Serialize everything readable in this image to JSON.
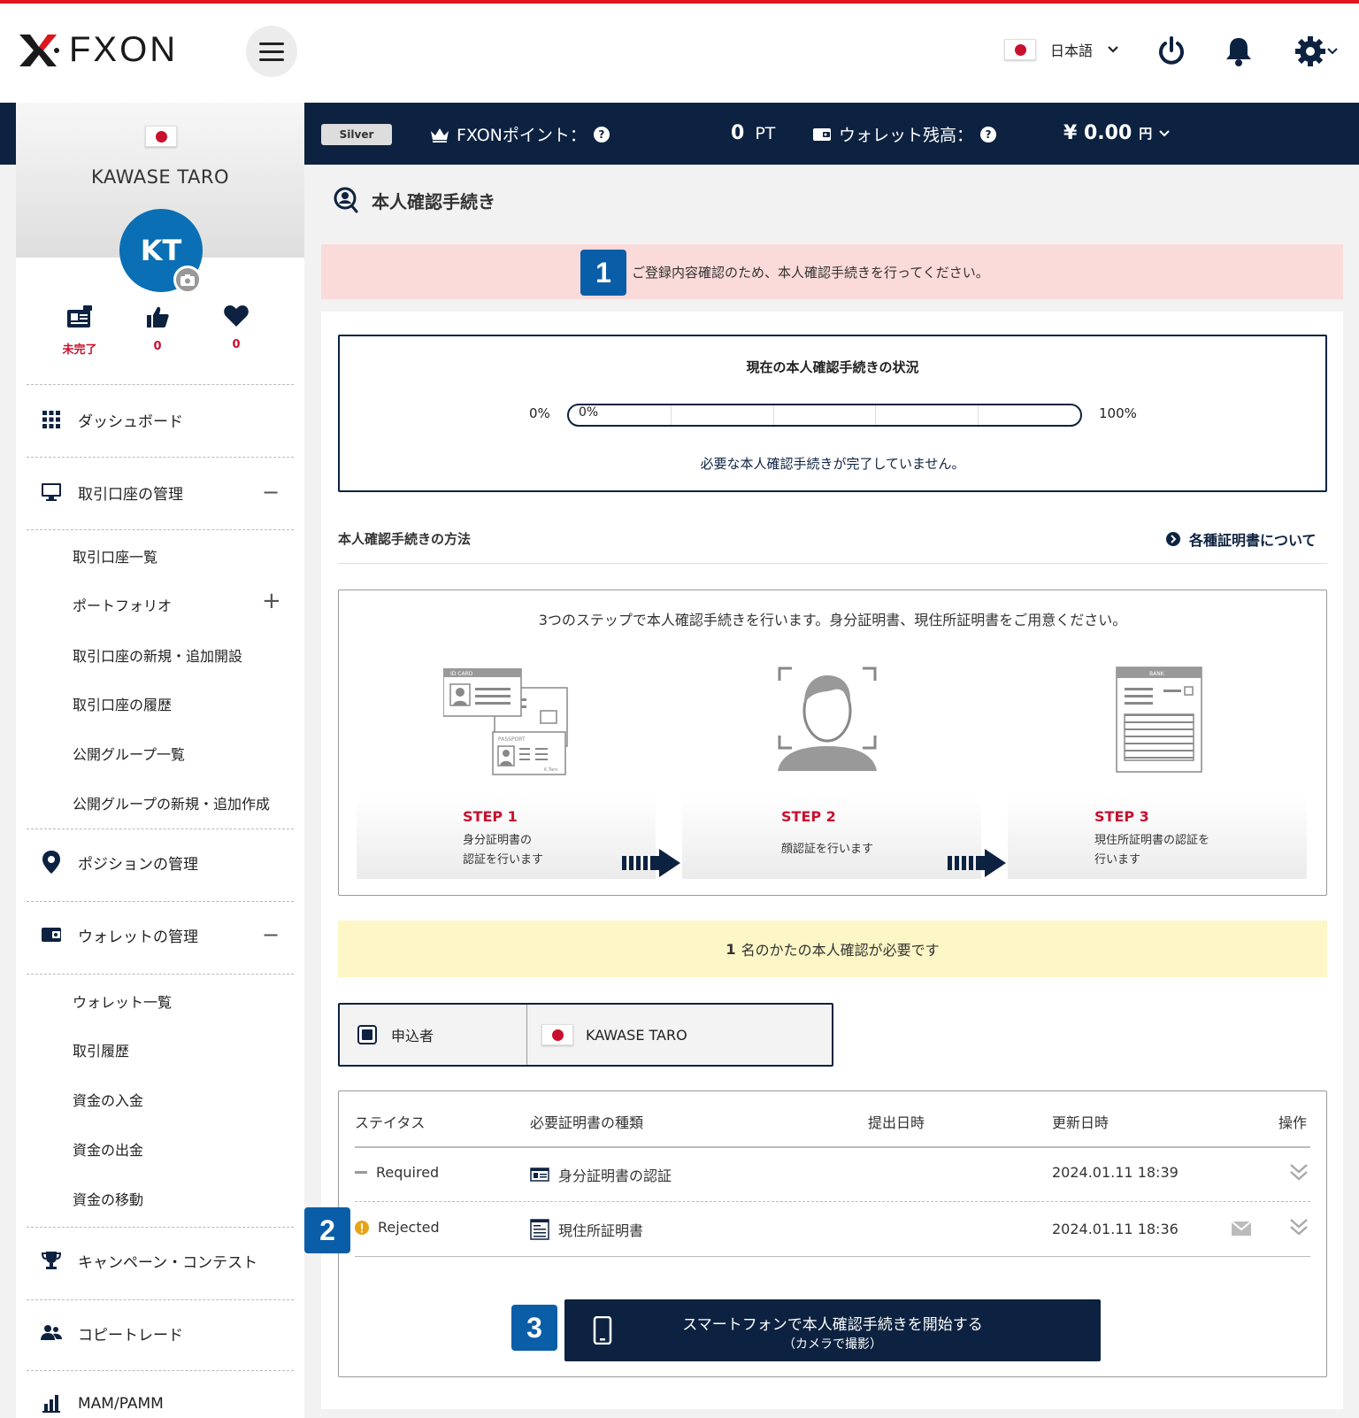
{
  "header": {
    "logo_text": "FXON",
    "language": "日本語"
  },
  "status_bar": {
    "tier": "Silver",
    "points_label": "FXONポイント：",
    "points_value": "0",
    "points_unit": "PT",
    "wallet_label": "ウォレット残高：",
    "wallet_value": "¥ 0.00",
    "wallet_unit": "円"
  },
  "sidebar": {
    "user_name": "KAWASE TARO",
    "avatar_initials": "KT",
    "stats": [
      {
        "icon": "id-card-icon",
        "value": "未完了"
      },
      {
        "icon": "thumbs-up-icon",
        "value": "0"
      },
      {
        "icon": "heart-icon",
        "value": "0"
      }
    ],
    "nav": {
      "dashboard": "ダッシュボード",
      "accounts": "取引口座の管理",
      "accounts_sub": [
        "取引口座一覧",
        "ポートフォリオ",
        "取引口座の新規・追加開設",
        "取引口座の履歴",
        "公開グループ一覧",
        "公開グループの新規・追加作成"
      ],
      "positions": "ポジションの管理",
      "wallet": "ウォレットの管理",
      "wallet_sub": [
        "ウォレット一覧",
        "取引履歴",
        "資金の入金",
        "資金の出金",
        "資金の移動"
      ],
      "campaign": "キャンペーン・コンテスト",
      "copytrade": "コピートレード",
      "mam": "MAM/PAMM"
    }
  },
  "main": {
    "page_title": "本人確認手続き",
    "alert_text": "ご登録内容確認のため、本人確認手続きを行ってください。",
    "badges": [
      "1",
      "2",
      "3"
    ],
    "status_box": {
      "title": "現在の本人確認手続きの状況",
      "min_label": "0%",
      "max_label": "100%",
      "progress_label": "0%",
      "progress": 0,
      "message": "必要な本人確認手続きが完了していません。"
    },
    "method_title": "本人確認手続きの方法",
    "method_link": "各種証明書について",
    "steps_intro": "3つのステップで本人確認手続きを行います。身分証明書、現住所証明書をご用意ください。",
    "steps": [
      {
        "title": "STEP 1",
        "line1": "身分証明書の",
        "line2": "認証を行います"
      },
      {
        "title": "STEP 2",
        "line1": "顔認証を行います",
        "line2": ""
      },
      {
        "title": "STEP 3",
        "line1": "現住所証明書の認証を",
        "line2": "行います"
      }
    ],
    "illustration_text": {
      "id_card": "ID CARD",
      "passport": "PASSPORT",
      "passport_sign": "K.Taro",
      "bank": "BANK"
    },
    "notice_count": "1",
    "notice_text": "名のかたの本人確認が必要です",
    "applicant_label": "申込者",
    "applicant_name": "KAWASE TARO",
    "table": {
      "headers": [
        "ステイタス",
        "必要証明書の種類",
        "提出日時",
        "更新日時",
        "操作"
      ],
      "rows": [
        {
          "status": "Required",
          "doc": "身分証明書の認証",
          "submitted": "",
          "updated": "2024.01.11 18:39"
        },
        {
          "status": "Rejected",
          "doc": "現住所証明書",
          "submitted": "",
          "updated": "2024.01.11 18:36"
        }
      ]
    },
    "start_button_line1": "スマートフォンで本人確認手続きを開始する",
    "start_button_line2": "（カメラで撮影）"
  },
  "colors": {
    "navy": "#0d2240",
    "accent_red": "#c8102e",
    "badge_blue": "#0a5ea8",
    "alert_bg": "#fbdada",
    "notice_bg": "#fdf6c6"
  }
}
